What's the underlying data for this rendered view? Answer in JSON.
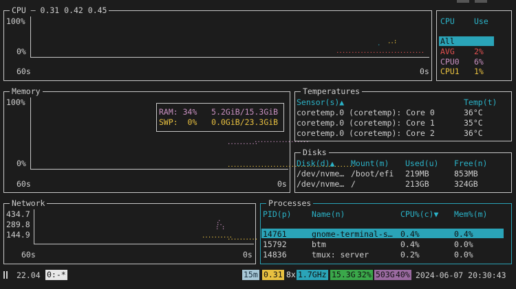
{
  "colors": {
    "teal": "#2aa4b8",
    "red": "#e05050",
    "pink": "#c890c0",
    "yellow": "#e8c040",
    "green": "#3aa84a",
    "purple": "#9a6aa0"
  },
  "cpu": {
    "title": "CPU — 0.31 0.42 0.45",
    "y_top": "100%",
    "y_bottom": "0%",
    "x_left": "60s",
    "x_right": "0s",
    "list_header_cpu": "CPU",
    "list_header_use": "Use",
    "rows": [
      {
        "name": "All",
        "use": ""
      },
      {
        "name": "AVG",
        "use": "2%"
      },
      {
        "name": "CPU0",
        "use": "6%"
      },
      {
        "name": "CPU1",
        "use": "1%"
      }
    ]
  },
  "memory": {
    "title": "Memory",
    "y_top": "100%",
    "y_bottom": "0%",
    "x_left": "60s",
    "x_right": "0s",
    "ram": "RAM: 34%   5.2GiB/15.3GiB",
    "swp": "SWP:  0%   0.0GiB/23.3GiB"
  },
  "temperatures": {
    "title": "Temperatures",
    "header_sensor": "Sensor(s)▲",
    "header_temp": "Temp(t)",
    "rows": [
      {
        "sensor": "coretemp.0 (coretemp): Core 0",
        "temp": "36°C"
      },
      {
        "sensor": "coretemp.0 (coretemp): Core 1",
        "temp": "35°C"
      },
      {
        "sensor": "coretemp.0 (coretemp): Core 2",
        "temp": "36°C"
      }
    ]
  },
  "disks": {
    "title": "Disks",
    "headers": [
      "Disk(d)▲",
      "Mount(m)",
      "Used(u)",
      "Free(n)"
    ],
    "rows": [
      [
        "/dev/nvme…",
        "/boot/efi",
        "219MB",
        "853MB"
      ],
      [
        "/dev/nvme…",
        "/",
        "213GB",
        "324GB"
      ]
    ]
  },
  "network": {
    "title": "Network",
    "y1": "434.7",
    "y2": "289.8",
    "y3": "144.9",
    "x_left": "60s",
    "x_right": "0s"
  },
  "processes": {
    "title": "Processes",
    "headers": [
      "PID(p)",
      "Name(n)",
      "CPU%(c)▼",
      "Mem%(m)"
    ],
    "rows": [
      [
        "14761",
        "gnome-terminal-s…",
        "0.4%",
        "0.4%"
      ],
      [
        "15792",
        "btm",
        "0.4%",
        "0.0%"
      ],
      [
        "14836",
        "tmux: server",
        "0.2%",
        "0.0%"
      ]
    ]
  },
  "statusbar": {
    "left_icon": "pause-bars-icon",
    "version": "22.04",
    "session": "0:-*",
    "tag_15m": "15m",
    "tag_load": "0.31",
    "tag_cpu_count": "8x",
    "tag_freq": "1.7GHz",
    "tag_mem_used": "15.3G",
    "tag_mem_pct": "32%",
    "tag_disk": "503G",
    "tag_disk_pct": "40%",
    "datetime": "2024-06-07 20:30:43"
  }
}
